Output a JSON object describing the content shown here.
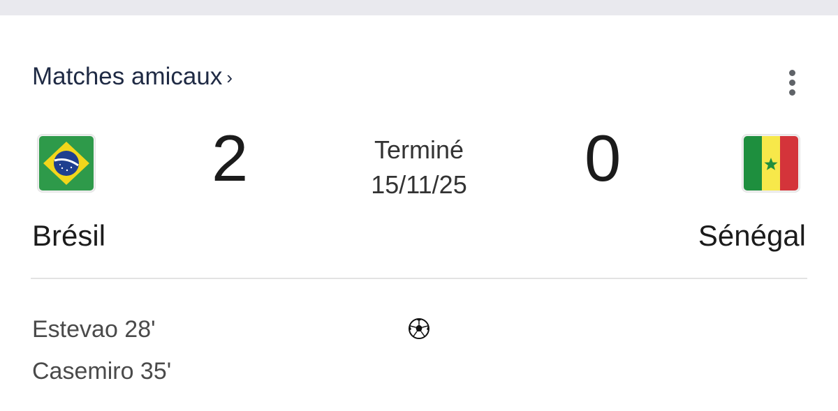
{
  "competition": {
    "name": "Matches amicaux",
    "chevron": "›"
  },
  "icons": {
    "more": "more-vert-icon",
    "goal": "soccer-ball-icon",
    "home_flag": "brazil-flag-icon",
    "away_flag": "senegal-flag-icon"
  },
  "match": {
    "status": "Terminé",
    "date": "15/11/25",
    "home": {
      "name": "Brésil",
      "score": "2"
    },
    "away": {
      "name": "Sénégal",
      "score": "0"
    }
  },
  "scorers": {
    "home": [
      {
        "text": "Estevao 28'"
      },
      {
        "text": "Casemiro 35'"
      }
    ]
  },
  "colors": {
    "brazil_green": "#2e9a4a",
    "brazil_yellow": "#f2d61b",
    "brazil_blue": "#1f3f8f",
    "senegal_green": "#1e8f3e",
    "senegal_yellow": "#f7e84a",
    "senegal_red": "#d4343a"
  }
}
